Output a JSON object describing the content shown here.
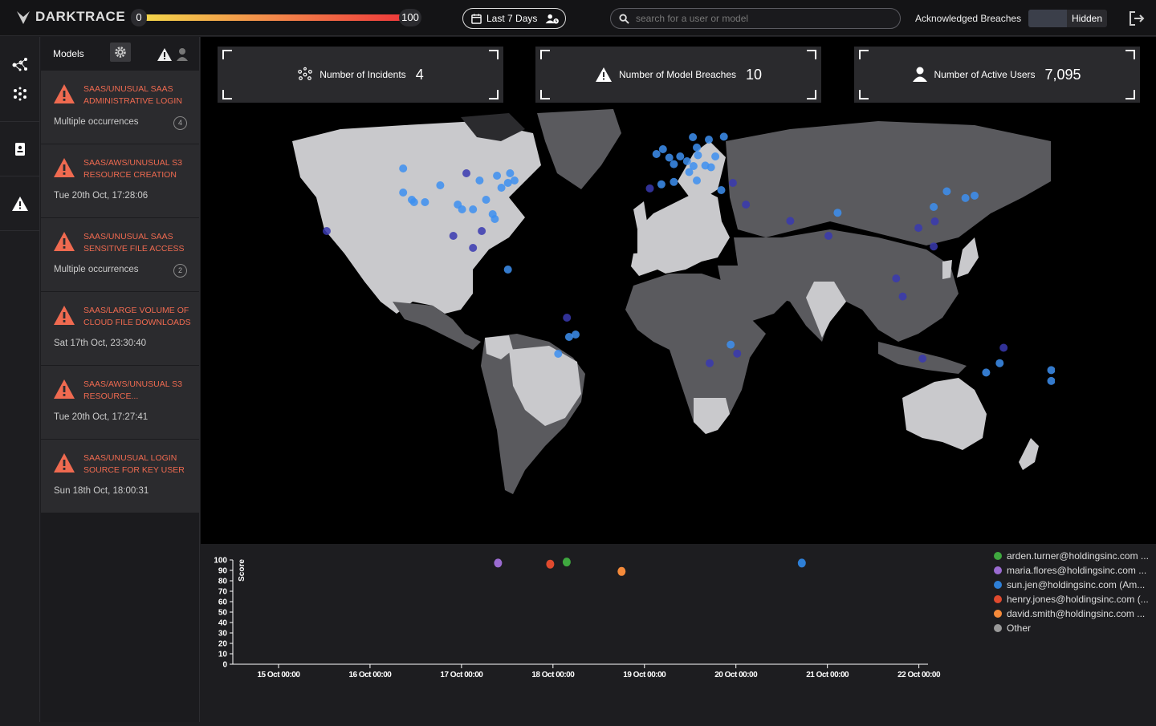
{
  "app": {
    "name": "DARKTRACE"
  },
  "threshold": {
    "min": "0",
    "max": "100"
  },
  "period": {
    "label": "Last 7 Days"
  },
  "search": {
    "placeholder": "search for a user or model"
  },
  "acknowledged": {
    "label": "Acknowledged Breaches",
    "state": "Hidden"
  },
  "sidebar": {
    "title": "Models",
    "breaches": [
      {
        "title": "SAAS/UNUSUAL SAAS ADMINISTRATIVE LOGIN",
        "sub": "Multiple occurrences",
        "count": "4"
      },
      {
        "title": "SAAS/AWS/UNUSUAL S3 RESOURCE CREATION",
        "sub": "Tue 20th Oct, 17:28:06",
        "count": ""
      },
      {
        "title": "SAAS/UNUSUAL SAAS SENSITIVE FILE ACCESS",
        "sub": "Multiple occurrences",
        "count": "2"
      },
      {
        "title": "SAAS/LARGE VOLUME OF CLOUD FILE DOWNLOADS",
        "sub": "Sat 17th Oct, 23:30:40",
        "count": ""
      },
      {
        "title": "SAAS/AWS/UNUSUAL S3 RESOURCE...",
        "sub": "Tue 20th Oct, 17:27:41",
        "count": ""
      },
      {
        "title": "SAAS/UNUSUAL LOGIN SOURCE FOR KEY USER",
        "sub": "Sun 18th Oct, 18:00:31",
        "count": ""
      }
    ]
  },
  "stats": {
    "incidents": {
      "label": "Number of Incidents",
      "value": "4"
    },
    "breaches": {
      "label": "Number of Model Breaches",
      "value": "10"
    },
    "users": {
      "label": "Number of Active Users",
      "value": "7,095"
    }
  },
  "colors": {
    "accent": "#ef6a50",
    "dot_light": "#3d8ff0",
    "dot_dark": "#3a3ab0"
  },
  "map_points": [
    {
      "lon": -122,
      "lat": 47,
      "tone": "light"
    },
    {
      "lon": -122,
      "lat": 37,
      "tone": "light"
    },
    {
      "lon": -118,
      "lat": 34,
      "tone": "light"
    },
    {
      "lon": -112,
      "lat": 33,
      "tone": "light"
    },
    {
      "lon": -105,
      "lat": 40,
      "tone": "light"
    },
    {
      "lon": -97,
      "lat": 32,
      "tone": "light"
    },
    {
      "lon": -95,
      "lat": 30,
      "tone": "light"
    },
    {
      "lon": -90,
      "lat": 30,
      "tone": "light"
    },
    {
      "lon": -87,
      "lat": 42,
      "tone": "light"
    },
    {
      "lon": -84,
      "lat": 34,
      "tone": "light"
    },
    {
      "lon": -80,
      "lat": 26,
      "tone": "light"
    },
    {
      "lon": -81,
      "lat": 28,
      "tone": "light"
    },
    {
      "lon": -77,
      "lat": 39,
      "tone": "light"
    },
    {
      "lon": -74,
      "lat": 41,
      "tone": "light"
    },
    {
      "lon": -71,
      "lat": 42,
      "tone": "light"
    },
    {
      "lon": -79,
      "lat": 44,
      "tone": "light"
    },
    {
      "lon": -73,
      "lat": 45,
      "tone": "light"
    },
    {
      "lon": -93,
      "lat": 45,
      "tone": "dark"
    },
    {
      "lon": -117,
      "lat": 33,
      "tone": "light"
    },
    {
      "lon": -99,
      "lat": 19,
      "tone": "dark"
    },
    {
      "lon": -86,
      "lat": 21,
      "tone": "dark"
    },
    {
      "lon": -90,
      "lat": 14,
      "tone": "dark"
    },
    {
      "lon": -157,
      "lat": 21,
      "tone": "dark"
    },
    {
      "lon": -74,
      "lat": 5,
      "tone": "light"
    },
    {
      "lon": -46,
      "lat": -23,
      "tone": "light"
    },
    {
      "lon": -43,
      "lat": -22,
      "tone": "light"
    },
    {
      "lon": -47,
      "lat": -15,
      "tone": "dark"
    },
    {
      "lon": -51,
      "lat": -30,
      "tone": "light"
    },
    {
      "lon": -0.1,
      "lat": 51.5,
      "tone": "light"
    },
    {
      "lon": -3,
      "lat": 55,
      "tone": "light"
    },
    {
      "lon": -6,
      "lat": 53,
      "tone": "light"
    },
    {
      "lon": 2,
      "lat": 48.8,
      "tone": "light"
    },
    {
      "lon": 4.9,
      "lat": 52,
      "tone": "light"
    },
    {
      "lon": 8,
      "lat": 50,
      "tone": "light"
    },
    {
      "lon": 13,
      "lat": 52.5,
      "tone": "light"
    },
    {
      "lon": 11,
      "lat": 48,
      "tone": "light"
    },
    {
      "lon": 9,
      "lat": 45.5,
      "tone": "light"
    },
    {
      "lon": 12.5,
      "lat": 42,
      "tone": "light"
    },
    {
      "lon": -3.7,
      "lat": 40.4,
      "tone": "light"
    },
    {
      "lon": 2,
      "lat": 41.4,
      "tone": "light"
    },
    {
      "lon": -9,
      "lat": 38.7,
      "tone": "dark"
    },
    {
      "lon": 18,
      "lat": 59,
      "tone": "light"
    },
    {
      "lon": 10.7,
      "lat": 60,
      "tone": "light"
    },
    {
      "lon": 12.5,
      "lat": 55.7,
      "tone": "light"
    },
    {
      "lon": 24.9,
      "lat": 60.2,
      "tone": "light"
    },
    {
      "lon": 21,
      "lat": 52,
      "tone": "light"
    },
    {
      "lon": 16.4,
      "lat": 48.2,
      "tone": "light"
    },
    {
      "lon": 19,
      "lat": 47.5,
      "tone": "light"
    },
    {
      "lon": 23.7,
      "lat": 38,
      "tone": "light"
    },
    {
      "lon": 29,
      "lat": 41,
      "tone": "dark"
    },
    {
      "lon": 35,
      "lat": 32,
      "tone": "dark"
    },
    {
      "lon": 55.3,
      "lat": 25.2,
      "tone": "dark"
    },
    {
      "lon": 77,
      "lat": 28.6,
      "tone": "light"
    },
    {
      "lon": 72.8,
      "lat": 19,
      "tone": "dark"
    },
    {
      "lon": 103.8,
      "lat": 1.3,
      "tone": "dark"
    },
    {
      "lon": 114,
      "lat": 22.3,
      "tone": "dark"
    },
    {
      "lon": 121,
      "lat": 31,
      "tone": "light"
    },
    {
      "lon": 121.5,
      "lat": 25,
      "tone": "dark"
    },
    {
      "lon": 127,
      "lat": 37.5,
      "tone": "light"
    },
    {
      "lon": 139.7,
      "lat": 35.7,
      "tone": "light"
    },
    {
      "lon": 135.5,
      "lat": 34.7,
      "tone": "light"
    },
    {
      "lon": 121,
      "lat": 14.6,
      "tone": "dark"
    },
    {
      "lon": 106.8,
      "lat": -6.2,
      "tone": "dark"
    },
    {
      "lon": 151.2,
      "lat": -33.9,
      "tone": "light"
    },
    {
      "lon": 145,
      "lat": -37.8,
      "tone": "light"
    },
    {
      "lon": 153,
      "lat": -27.5,
      "tone": "dark"
    },
    {
      "lon": 115.9,
      "lat": -32,
      "tone": "dark"
    },
    {
      "lon": 174.8,
      "lat": -36.8,
      "tone": "light"
    },
    {
      "lon": 174.8,
      "lat": -41.3,
      "tone": "light"
    },
    {
      "lon": 28,
      "lat": -26.2,
      "tone": "light"
    },
    {
      "lon": 18.4,
      "lat": -33.9,
      "tone": "dark"
    },
    {
      "lon": 31,
      "lat": -29.9,
      "tone": "dark"
    }
  ],
  "chart_data": {
    "type": "scatter",
    "ylabel": "Score",
    "xlabel": "",
    "ylim": [
      0,
      100
    ],
    "yticks": [
      "0",
      "10",
      "20",
      "30",
      "40",
      "50",
      "60",
      "70",
      "80",
      "90",
      "100"
    ],
    "xticks": [
      "15 Oct 00:00",
      "16 Oct 00:00",
      "17 Oct 00:00",
      "18 Oct 00:00",
      "19 Oct 00:00",
      "20 Oct 00:00",
      "21 Oct 00:00",
      "22 Oct 00:00"
    ],
    "xlim_days": [
      14.5,
      22.1
    ],
    "series": [
      {
        "name": "arden.turner@holdingsinc.com ...",
        "color": "#3fa83f",
        "points": [
          {
            "x": 18.15,
            "y": 98
          }
        ]
      },
      {
        "name": "maria.flores@holdingsinc.com ...",
        "color": "#9b6bd1",
        "points": [
          {
            "x": 17.4,
            "y": 97
          }
        ]
      },
      {
        "name": "sun.jen@holdingsinc.com (Am...",
        "color": "#2e7fd6",
        "points": [
          {
            "x": 20.72,
            "y": 97
          }
        ]
      },
      {
        "name": "henry.jones@holdingsinc.com (...",
        "color": "#e04a2e",
        "points": [
          {
            "x": 17.97,
            "y": 96
          }
        ]
      },
      {
        "name": "david.smith@holdingsinc.com ...",
        "color": "#f58a3a",
        "points": [
          {
            "x": 18.75,
            "y": 89
          }
        ]
      },
      {
        "name": "Other",
        "color": "#999999",
        "points": []
      }
    ]
  }
}
